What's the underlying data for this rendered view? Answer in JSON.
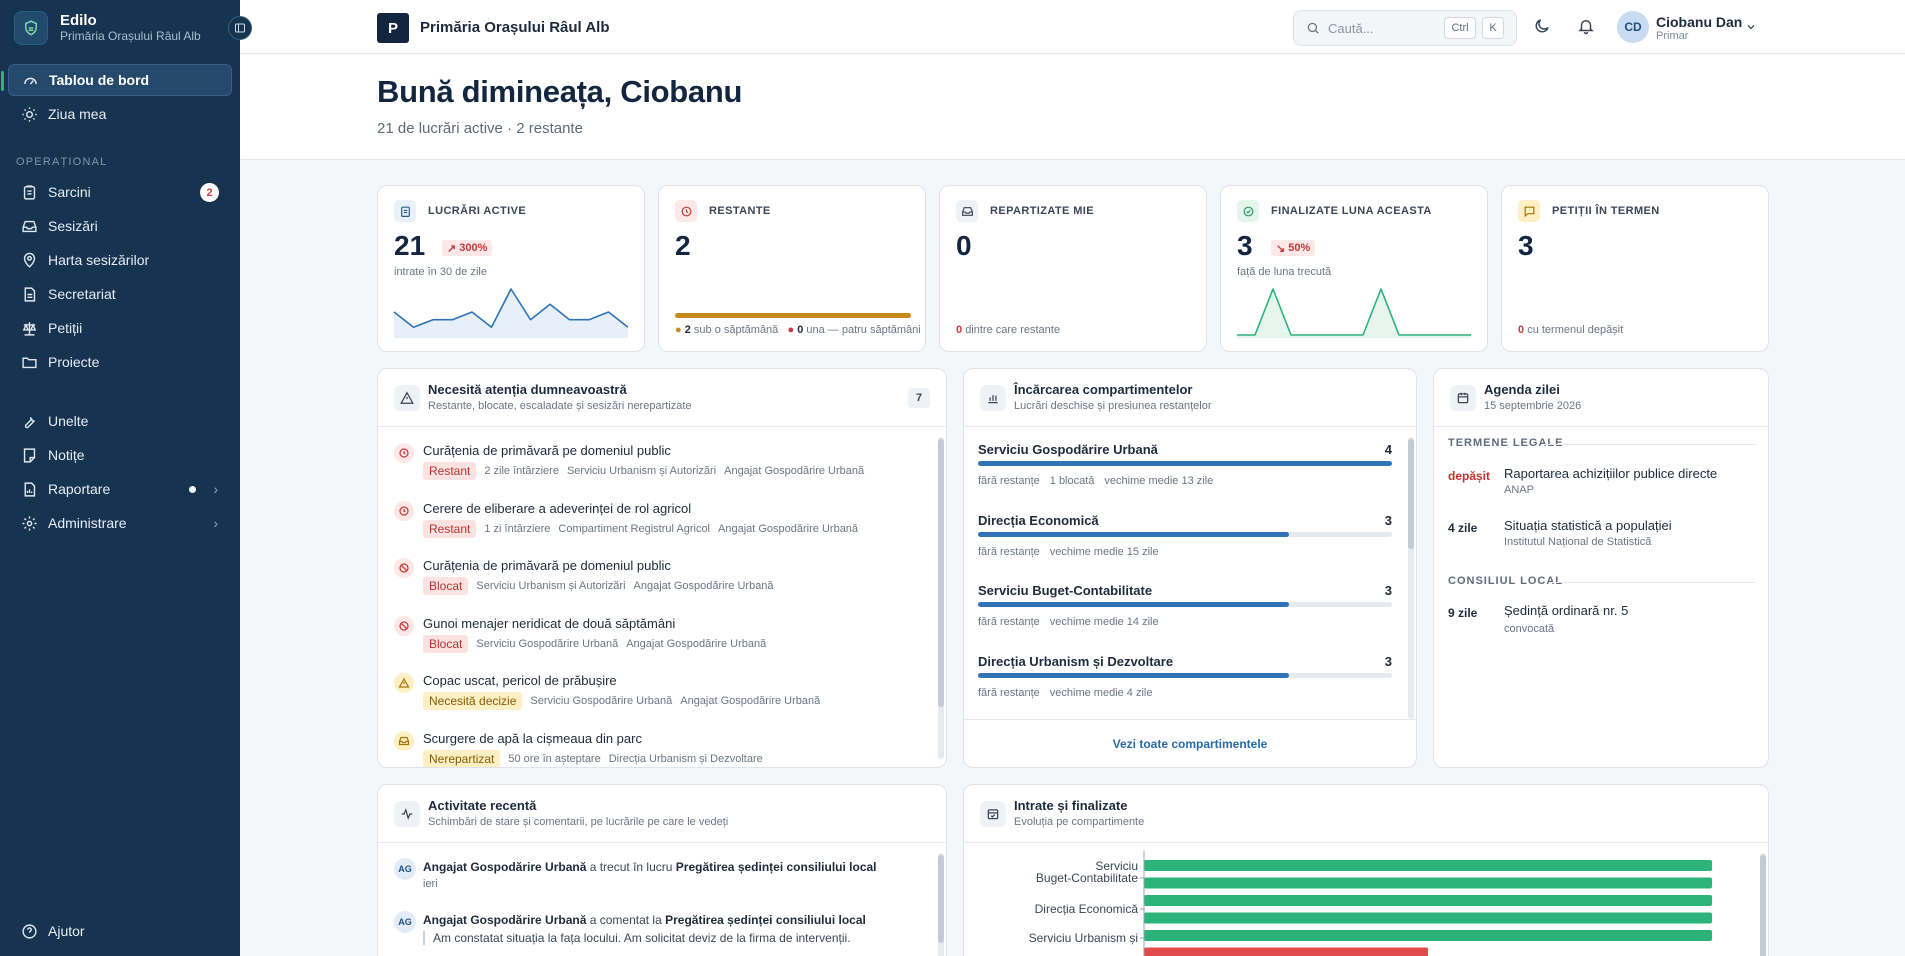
{
  "sidebar": {
    "brand_name": "Edilo",
    "brand_sub": "Primăria Orașului Râul Alb",
    "items": {
      "dashboard": "Tablou de bord",
      "my_day": "Ziua mea",
      "section_operational": "OPERAȚIONAL",
      "tasks": "Sarcini",
      "tasks_badge": "2",
      "reports_in": "Sesizări",
      "map": "Harta sesizărilor",
      "secretariat": "Secretariat",
      "petitions": "Petiții",
      "projects": "Proiecte",
      "tools": "Unelte",
      "notes": "Notițe",
      "reporting": "Raportare",
      "admin": "Administrare",
      "help": "Ajutor"
    }
  },
  "topbar": {
    "org_initial": "P",
    "org_name": "Primăria Orașului Râul Alb",
    "search_placeholder": "Caută...",
    "kbd_ctrl": "Ctrl",
    "kbd_k": "K",
    "user_initials": "CD",
    "user_name": "Ciobanu Dan",
    "user_role": "Primar"
  },
  "hero": {
    "greeting": "Bună dimineața, Ciobanu",
    "summary": "21 de lucrări active · 2 restante"
  },
  "kpis": {
    "active": {
      "title": "LUCRĂRI ACTIVE",
      "value": "21",
      "chip": "300%",
      "sub": "intrate în 30 de zile",
      "spark": [
        3,
        1,
        2,
        2,
        3,
        1,
        6,
        2,
        4,
        2,
        2,
        3,
        1
      ]
    },
    "overdue": {
      "title": "RESTANTE",
      "value": "2",
      "foot_a_num": "2",
      "foot_a_text": "sub o săptămână",
      "foot_b_num": "0",
      "foot_b_text": "una — patru săptămâni",
      "progress": 1.0
    },
    "assigned": {
      "title": "REPARTIZATE MIE",
      "value": "0",
      "foot_num": "0",
      "foot_text": "dintre care restante"
    },
    "done": {
      "title": "FINALIZATE LUNA ACEASTA",
      "value": "3",
      "chip": "50%",
      "sub": "față de luna trecută",
      "spark": [
        0,
        0,
        3,
        0,
        0,
        0,
        0,
        0,
        3,
        0,
        0,
        0,
        0,
        0
      ]
    },
    "petitions": {
      "title": "PETIȚII ÎN TERMEN",
      "value": "3",
      "foot_num": "0",
      "foot_text": "cu termenul depășit"
    }
  },
  "colors": {
    "sidebar": "#16334f",
    "accent_green": "#2bb37a",
    "accent_blue": "#2f74b6",
    "danger": "#d23a3a",
    "warning": "#c58a1a"
  },
  "attention": {
    "title": "Necesită atenția dumneavoastră",
    "subtitle": "Restante, blocate, escaladate și sesizări nerepartizate",
    "count": "7",
    "items": [
      {
        "title": "Curățenia de primăvară pe domeniul public",
        "tag": "Restant",
        "meta": [
          "2 zile întârziere",
          "Serviciu Urbanism și Autorizări",
          "Angajat Gospodărire Urbană"
        ],
        "icon": "clock-icon"
      },
      {
        "title": "Cerere de eliberare a adeverinței de rol agricol",
        "tag": "Restant",
        "meta": [
          "1 zi întârziere",
          "Compartiment Registrul Agricol",
          "Angajat Gospodărire Urbană"
        ],
        "icon": "clock-icon"
      },
      {
        "title": "Curățenia de primăvară pe domeniul public",
        "tag": "Blocat",
        "meta": [
          "Serviciu Urbanism și Autorizări",
          "Angajat Gospodărire Urbană"
        ],
        "icon": "blocked-icon"
      },
      {
        "title": "Gunoi menajer neridicat de două săptămâni",
        "tag": "Blocat",
        "meta": [
          "Serviciu Gospodărire Urbană",
          "Angajat Gospodărire Urbană"
        ],
        "icon": "blocked-icon"
      },
      {
        "title": "Copac uscat, pericol de prăbușire",
        "tag": "Necesită decizie",
        "meta": [
          "Serviciu Gospodărire Urbană",
          "Angajat Gospodărire Urbană"
        ],
        "icon": "warning-icon"
      },
      {
        "title": "Scurgere de apă la cișmeaua din parc",
        "tag": "Nerepartizat",
        "meta": [
          "50 ore în așteptare",
          "Direcția Urbanism și Dezvoltare"
        ],
        "icon": "inbox-icon"
      }
    ]
  },
  "departments": {
    "title": "Încărcarea compartimentelor",
    "subtitle": "Lucrări deschise și presiunea restanțelor",
    "link": "Vezi toate compartimentele",
    "items": [
      {
        "name": "Serviciu Gospodărire Urbană",
        "count": "4",
        "load": 1.0,
        "meta": [
          "fără restanțe",
          "1 blocată",
          "vechime medie 13 zile"
        ]
      },
      {
        "name": "Direcția Economică",
        "count": "3",
        "load": 0.75,
        "meta": [
          "fără restanțe",
          "vechime medie 15 zile"
        ]
      },
      {
        "name": "Serviciu Buget-Contabilitate",
        "count": "3",
        "load": 0.75,
        "meta": [
          "fără restanțe",
          "vechime medie 14 zile"
        ]
      },
      {
        "name": "Direcția Urbanism și Dezvoltare",
        "count": "3",
        "load": 0.75,
        "meta": [
          "fără restanțe",
          "vechime medie 4 zile"
        ]
      }
    ]
  },
  "agenda": {
    "title": "Agenda zilei",
    "date": "15 septembrie 2026",
    "legal_label": "TERMENE LEGALE",
    "council_label": "CONSILIUL LOCAL",
    "legal": [
      {
        "when": "depășit",
        "title": "Raportarea achizițiilor publice directe",
        "sub": "ANAP"
      },
      {
        "when": "4 zile",
        "title": "Situația statistică a populației",
        "sub": "Institutul Național de Statistică"
      }
    ],
    "council": [
      {
        "when": "9 zile",
        "title": "Ședință ordinară nr. 5",
        "sub": "convocată"
      }
    ]
  },
  "activity": {
    "title": "Activitate recentă",
    "subtitle": "Schimbări de stare și comentarii, pe lucrările pe care le vedeți",
    "items": [
      {
        "initials": "AG",
        "actor": "Angajat Gospodărire Urbană",
        "verb": "a trecut în lucru",
        "object": "Pregătirea ședinței consiliului local",
        "time": "ieri"
      },
      {
        "initials": "AG",
        "actor": "Angajat Gospodărire Urbană",
        "verb": "a comentat la",
        "object": "Pregătirea ședinței consiliului local",
        "quote": "Am constatat situația la fața locului. Am solicitat deviz de la firma de intervenții."
      }
    ]
  },
  "flow": {
    "title": "Intrate și finalizate",
    "subtitle": "Evoluția pe compartimente"
  },
  "chart_data": {
    "type": "bar",
    "orientation": "horizontal",
    "categories": [
      "Serviciu Buget-Contabilitate",
      "Direcția Economică",
      "Serviciu Urbanism și"
    ],
    "category_label_lines": [
      [
        "Serviciu",
        "Buget-Contabilitate"
      ],
      [
        "Direcția Economică"
      ],
      [
        "Serviciu Urbanism și"
      ]
    ],
    "series_colors": [
      "#2bb37a",
      "#2bb37a",
      "#2bb37a",
      "#2bb37a",
      "#2bb37a",
      "#e14b4b"
    ],
    "bar_values": [
      1.0,
      1.0,
      1.0,
      1.0,
      1.0,
      0.5
    ]
  }
}
